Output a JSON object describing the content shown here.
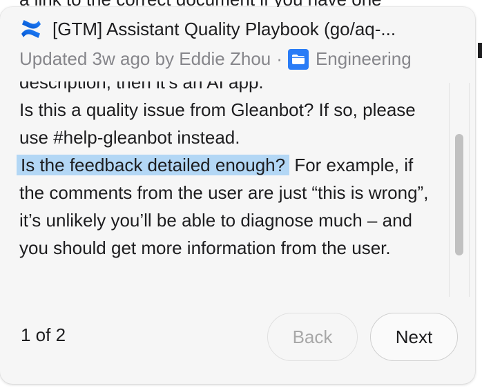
{
  "background": {
    "partial_text": "a link to the correct document if you have one"
  },
  "header": {
    "title": "[GTM] Assistant Quality Playbook (go/aq-...",
    "updated": "Updated 3w ago by Eddie Zhou",
    "separator": "·",
    "folder": "Engineering",
    "logo_icon": "confluence-logo-icon",
    "folder_icon": "folder-icon"
  },
  "content": {
    "line_cut": "description, then it’s an AI app.",
    "para1": "Is this a quality issue from Gleanbot? If so, please use #help-gleanbot instead.",
    "highlight": "Is the feedback detailed enough?",
    "para2_rest": " For example, if the comments from the user are just “this is wrong”, it’s unlikely you’ll be able to diagnose much – and you should get more information from the user."
  },
  "footer": {
    "page_indicator": "1 of 2",
    "back_label": "Back",
    "next_label": "Next"
  },
  "colors": {
    "accent": "#2a7cf6",
    "highlight": "#b3d7f5",
    "muted_text": "#86868b",
    "text": "#1d1d1f"
  }
}
